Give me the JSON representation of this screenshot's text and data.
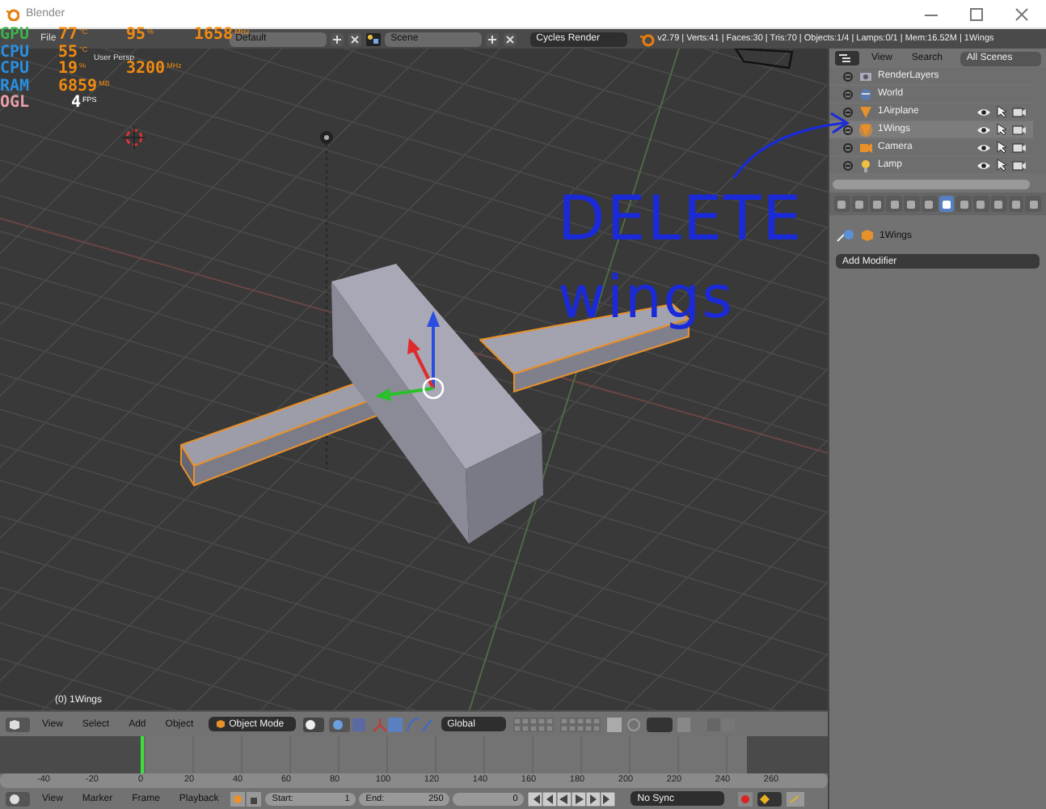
{
  "window": {
    "title": "Blender"
  },
  "info_header": {
    "menus": [
      "File"
    ],
    "layout": "Default",
    "scene": "Scene",
    "engine": "Cycles Render",
    "stats": "v2.79 | Verts:41 | Faces:30 | Tris:70 | Objects:1/4 | Lamps:0/1 | Mem:16.52M | 1Wings"
  },
  "hw_overlay": [
    {
      "label": "GPU",
      "color": "#3cb34a",
      "readings": [
        {
          "value": "77",
          "unit": "°C"
        },
        {
          "value": "95",
          "unit": "%"
        },
        {
          "value": "1658",
          "unit": "MHz"
        }
      ]
    },
    {
      "label": "CPU",
      "color": "#2a8fe0",
      "readings": [
        {
          "value": "55",
          "unit": "°C"
        }
      ]
    },
    {
      "label": "CPU",
      "color": "#2a8fe0",
      "readings": [
        {
          "value": "19",
          "unit": "%"
        },
        {
          "value": "3200",
          "unit": "MHz"
        }
      ]
    },
    {
      "label": "RAM",
      "color": "#2a8fe0",
      "readings": [
        {
          "value": "6859",
          "unit": "MB"
        }
      ]
    },
    {
      "label": "OGL",
      "color": "#e8a0a8",
      "readings": [
        {
          "value": "4",
          "unit": "FPS",
          "kind": "plain"
        }
      ]
    }
  ],
  "viewport": {
    "view_label": "User Persp",
    "object_label": "(0) 1Wings"
  },
  "annotation": {
    "lines": [
      "DELETE",
      "wings"
    ]
  },
  "outliner": {
    "menus": [
      "View",
      "Search"
    ],
    "filter": "All Scenes",
    "items": [
      {
        "name": "RenderLayers",
        "kind": "renderlayers",
        "selected": false
      },
      {
        "name": "World",
        "kind": "world",
        "selected": false
      },
      {
        "name": "1Airplane",
        "kind": "mesh",
        "selected": false
      },
      {
        "name": "1Wings",
        "kind": "mesh",
        "selected": true
      },
      {
        "name": "Camera",
        "kind": "camera",
        "selected": false
      },
      {
        "name": "Lamp",
        "kind": "lamp",
        "selected": false
      }
    ]
  },
  "properties": {
    "tabs": [
      {
        "selected": false
      },
      {
        "selected": false
      },
      {
        "selected": false
      },
      {
        "selected": false
      },
      {
        "selected": false
      },
      {
        "selected": false
      },
      {
        "selected": true
      },
      {
        "selected": false
      },
      {
        "selected": false
      },
      {
        "selected": false
      },
      {
        "selected": false
      },
      {
        "selected": false
      }
    ],
    "context": "1Wings",
    "add_modifier": "Add Modifier"
  },
  "view3d_header": {
    "menus": [
      "View",
      "Select",
      "Add",
      "Object"
    ],
    "mode": "Object Mode",
    "orientation": "Global"
  },
  "timeline": {
    "ticks": [
      "-40",
      "-20",
      "0",
      "20",
      "40",
      "60",
      "80",
      "100",
      "120",
      "140",
      "160",
      "180",
      "200",
      "220",
      "240",
      "260"
    ],
    "menus": [
      "View",
      "Marker",
      "Frame",
      "Playback"
    ],
    "start": {
      "label": "Start:",
      "value": "1"
    },
    "end": {
      "label": "End:",
      "value": "250"
    },
    "current": "0",
    "sync": "No Sync"
  }
}
